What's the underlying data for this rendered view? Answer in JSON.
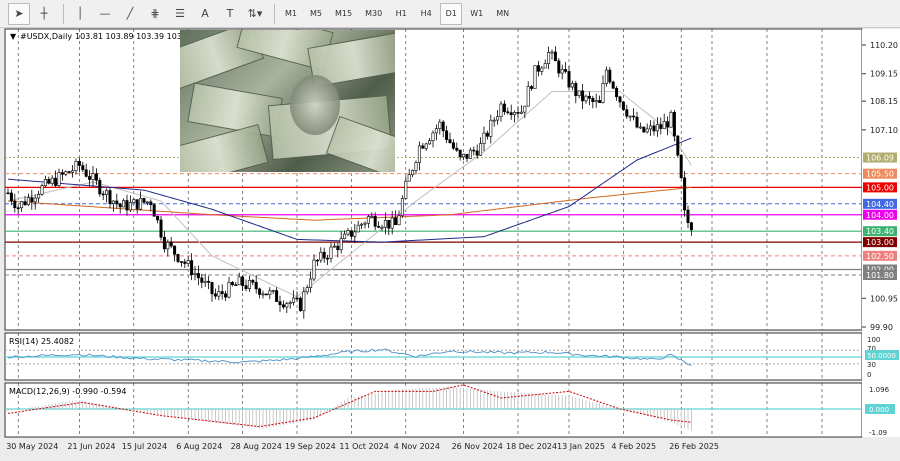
{
  "toolbar": {
    "tools": [
      "cursor-icon",
      "crosshair-icon",
      "vertical-line-icon",
      "horizontal-line-icon",
      "trendline-icon",
      "andrews-pitchfork-icon",
      "fibonacci-icon",
      "text-icon",
      "text-label-icon",
      "arrows-icon"
    ],
    "text_tool": "A",
    "timeframes": [
      "M1",
      "M5",
      "M15",
      "M30",
      "H1",
      "H4",
      "D1",
      "W1",
      "MN"
    ],
    "active_timeframe": "D1"
  },
  "chart_data": {
    "type": "candlestick",
    "title": "#USDX,Daily",
    "ohlc": "103.81 103.89 103.39 103.45",
    "bars": 202,
    "ylim": [
      99.5,
      110.6
    ],
    "y_ticks": [
      "110.20",
      "109.15",
      "108.15",
      "107.10",
      "100.95",
      "99.90"
    ],
    "y_tick_values": [
      110.2,
      109.15,
      108.15,
      107.1,
      100.95,
      99.9
    ],
    "x_ticks": [
      "30 May 2024",
      "21 Jun 2024",
      "15 Jul 2024",
      "6 Aug 2024",
      "28 Aug 2024",
      "19 Sep 2024",
      "11 Oct 2024",
      "4 Nov 2024",
      "26 Nov 2024",
      "18 Dec 2024",
      "13 Jan 2025",
      "4 Feb 2025",
      "26 Feb 2025"
    ],
    "x_tick_bars": [
      3,
      21,
      37,
      53,
      69,
      85,
      101,
      117,
      134,
      150,
      165,
      181,
      198
    ],
    "close_keypoints": [
      [
        0,
        104.8
      ],
      [
        3,
        104.3
      ],
      [
        9,
        104.9
      ],
      [
        21,
        105.8
      ],
      [
        27,
        105.0
      ],
      [
        33,
        104.3
      ],
      [
        42,
        104.5
      ],
      [
        46,
        103.0
      ],
      [
        54,
        102.0
      ],
      [
        61,
        101.0
      ],
      [
        68,
        101.5
      ],
      [
        74,
        101.3
      ],
      [
        80,
        100.9
      ],
      [
        86,
        100.7
      ],
      [
        90,
        102.2
      ],
      [
        98,
        103.0
      ],
      [
        106,
        103.9
      ],
      [
        114,
        103.6
      ],
      [
        117,
        105.0
      ],
      [
        121,
        106.5
      ],
      [
        127,
        107.3
      ],
      [
        133,
        106.0
      ],
      [
        139,
        106.5
      ],
      [
        145,
        108.0
      ],
      [
        151,
        107.8
      ],
      [
        155,
        109.2
      ],
      [
        159,
        109.9
      ],
      [
        164,
        109.0
      ],
      [
        168,
        108.3
      ],
      [
        174,
        108.0
      ],
      [
        176,
        109.3
      ],
      [
        180,
        108.2
      ],
      [
        186,
        107.0
      ],
      [
        192,
        107.2
      ],
      [
        195,
        107.5
      ],
      [
        198,
        105.2
      ],
      [
        199,
        104.0
      ],
      [
        201,
        103.45
      ]
    ],
    "ma_blue": [
      [
        0,
        105.3
      ],
      [
        40,
        104.9
      ],
      [
        60,
        104.2
      ],
      [
        85,
        103.1
      ],
      [
        110,
        103.0
      ],
      [
        140,
        103.2
      ],
      [
        165,
        104.3
      ],
      [
        185,
        106.0
      ],
      [
        201,
        106.8
      ]
    ],
    "ma_orange": [
      [
        0,
        104.5
      ],
      [
        60,
        104.0
      ],
      [
        90,
        103.8
      ],
      [
        130,
        104.0
      ],
      [
        170,
        104.6
      ],
      [
        201,
        105.0
      ]
    ],
    "ma_gray": [
      [
        0,
        104.5
      ],
      [
        25,
        105.2
      ],
      [
        45,
        104.5
      ],
      [
        60,
        102.5
      ],
      [
        85,
        101.0
      ],
      [
        100,
        102.5
      ],
      [
        120,
        104.5
      ],
      [
        140,
        106.3
      ],
      [
        160,
        108.5
      ],
      [
        180,
        108.5
      ],
      [
        195,
        107.0
      ],
      [
        201,
        105.8
      ]
    ],
    "levels": [
      {
        "label": "106.09",
        "value": 106.09,
        "color": "#b0ad6e",
        "style": "dot"
      },
      {
        "label": "105.50",
        "value": 105.5,
        "color": "#f08a5d",
        "style": "dash"
      },
      {
        "label": "105.00",
        "value": 105.0,
        "color": "#ee0000",
        "style": "solid"
      },
      {
        "label": "104.40",
        "value": 104.4,
        "color": "#4169e1",
        "style": "dash"
      },
      {
        "label": "104.00",
        "value": 104.0,
        "color": "#ee00ee",
        "style": "solid"
      },
      {
        "label": "103.40",
        "value": 103.4,
        "color": "#3cb371",
        "style": "solid"
      },
      {
        "label": "103.00",
        "value": 103.0,
        "color": "#800000",
        "style": "solid"
      },
      {
        "label": "102.50",
        "value": 102.5,
        "color": "#f08080",
        "style": "dash"
      },
      {
        "label": "102.00",
        "value": 102.0,
        "color": "#808080",
        "style": "solid"
      },
      {
        "label": "101.80",
        "value": 101.8,
        "color": "#808080",
        "style": "dash"
      }
    ],
    "rsi": {
      "label": "RSI(14) 25.4082",
      "levels": [
        "100",
        "70",
        "50.0000",
        "30",
        "0"
      ],
      "keypoints": [
        [
          0,
          50
        ],
        [
          20,
          58
        ],
        [
          40,
          45
        ],
        [
          55,
          40
        ],
        [
          70,
          35
        ],
        [
          85,
          45
        ],
        [
          100,
          65
        ],
        [
          110,
          72
        ],
        [
          120,
          52
        ],
        [
          130,
          68
        ],
        [
          145,
          62
        ],
        [
          160,
          64
        ],
        [
          170,
          55
        ],
        [
          180,
          50
        ],
        [
          190,
          42
        ],
        [
          195,
          55
        ],
        [
          201,
          25.4
        ]
      ]
    },
    "macd": {
      "label": "MACD(12,26,9) -0.990 -0.594",
      "levels": [
        "1.096",
        "0.000",
        "-1.09"
      ],
      "hist": [
        [
          0,
          -0.1
        ],
        [
          20,
          0.4
        ],
        [
          35,
          0
        ],
        [
          55,
          -0.5
        ],
        [
          75,
          -0.9
        ],
        [
          90,
          -0.5
        ],
        [
          100,
          0.5
        ],
        [
          115,
          0.9
        ],
        [
          130,
          1.0
        ],
        [
          145,
          0.8
        ],
        [
          165,
          0.6
        ],
        [
          180,
          0
        ],
        [
          195,
          -0.6
        ],
        [
          201,
          -1.0
        ]
      ],
      "signal": [
        [
          0,
          -0.2
        ],
        [
          22,
          0.3
        ],
        [
          45,
          -0.3
        ],
        [
          74,
          -0.8
        ],
        [
          90,
          -0.4
        ],
        [
          108,
          0.8
        ],
        [
          125,
          0.8
        ],
        [
          134,
          1.1
        ],
        [
          145,
          0.5
        ],
        [
          165,
          0.8
        ],
        [
          180,
          0
        ],
        [
          195,
          -0.5
        ],
        [
          201,
          -0.6
        ]
      ]
    }
  }
}
